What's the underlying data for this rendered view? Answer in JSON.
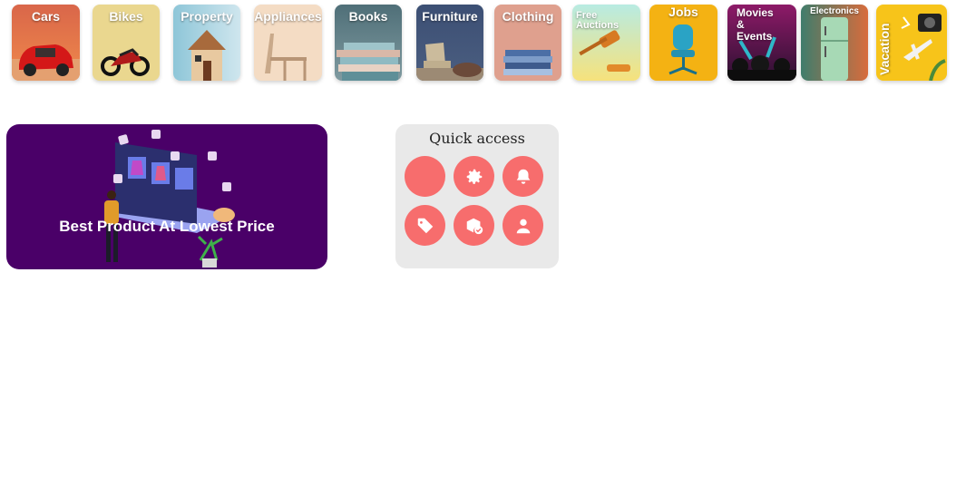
{
  "categories": [
    {
      "label": "Cars",
      "icon": "car-icon"
    },
    {
      "label": "Bikes",
      "icon": "motorbike-icon"
    },
    {
      "label": "Property",
      "icon": "house-icon"
    },
    {
      "label": "Appliances",
      "icon": "appliance-icon"
    },
    {
      "label": "Books",
      "icon": "books-icon"
    },
    {
      "label": "Furniture",
      "icon": "armchair-icon"
    },
    {
      "label": "Clothing",
      "icon": "clothes-icon"
    },
    {
      "label": "Free Auctions",
      "icon": "gavel-icon"
    },
    {
      "label": "Jobs",
      "icon": "office-chair-icon"
    },
    {
      "label": "Movies & Events",
      "icon": "crowd-icon"
    },
    {
      "label": "Electronics",
      "icon": "fridge-icon"
    },
    {
      "label": "Vacation",
      "icon": "travel-icon"
    }
  ],
  "banner": {
    "text": "Best Product At Lowest Price"
  },
  "quick_access": {
    "title": "Quick access",
    "buttons": [
      {
        "icon": "blank-icon"
      },
      {
        "icon": "gear-icon"
      },
      {
        "icon": "bell-icon"
      },
      {
        "icon": "tag-icon"
      },
      {
        "icon": "package-check-icon"
      },
      {
        "icon": "user-icon"
      }
    ]
  },
  "colors": {
    "banner_bg": "#4a0068",
    "accent": "#f76d6d",
    "panel_bg": "#e9e9e9"
  }
}
